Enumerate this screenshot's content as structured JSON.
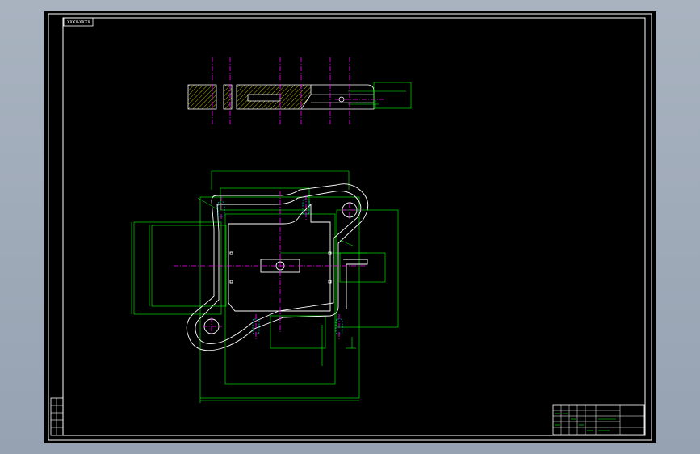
{
  "drawing": {
    "drawing_code": "XXXX-XXXX",
    "title_block": {
      "rows": [
        "",
        "",
        "",
        "",
        ""
      ],
      "part_name": "",
      "material": ""
    },
    "side_strip": [
      "",
      "",
      "",
      "",
      ""
    ]
  }
}
